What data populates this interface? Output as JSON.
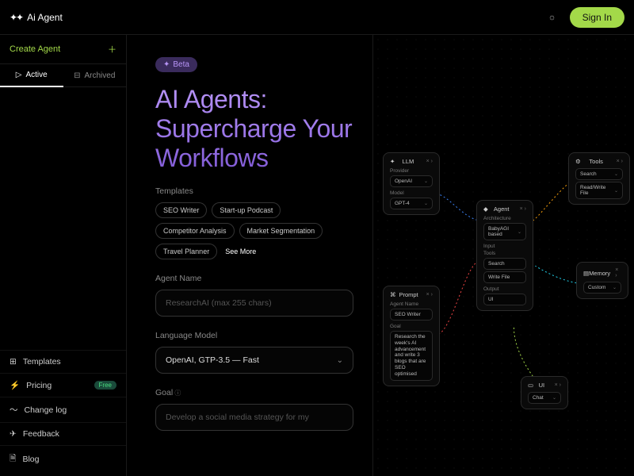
{
  "brand": "Ai Agent",
  "topbar": {
    "signin": "Sign In"
  },
  "sidebar": {
    "create": "Create Agent",
    "tabs": {
      "active": "Active",
      "archived": "Archived"
    },
    "nav": {
      "templates": "Templates",
      "pricing": "Pricing",
      "pricing_badge": "Free",
      "changelog": "Change log",
      "feedback": "Feedback",
      "blog": "Blog"
    }
  },
  "beta": "Beta",
  "hero": "AI Agents: Supercharge Your Workflows",
  "templates_label": "Templates",
  "templates": [
    "SEO Writer",
    "Start-up Podcast",
    "Competitor Analysis",
    "Market Segmentation",
    "Travel Planner"
  ],
  "see_more": "See More",
  "agent_name_label": "Agent Name",
  "agent_name_placeholder": "ResearchAI (max 255 chars)",
  "lm_label": "Language Model",
  "lm_value": "OpenAI, GTP-3.5 — Fast",
  "goal_label": "Goal",
  "goal_placeholder": "Develop a social media strategy for my",
  "graph": {
    "llm": {
      "title": "LLM",
      "provider_label": "Provider",
      "provider": "OpenAI",
      "model_label": "Model",
      "model": "GPT-4"
    },
    "prompt": {
      "title": "Prompt",
      "name_label": "Agent Name",
      "name": "SEO Writer",
      "goal_label": "Goal",
      "goal": "Research the week's AI advancement and write 3 blogs that are SEO optimised"
    },
    "agent": {
      "title": "Agent",
      "arch_label": "Architecture",
      "arch": "BabyAGI based",
      "input_label": "Input",
      "tools_label": "Tools",
      "tools": [
        "Search",
        "Write File"
      ],
      "output_label": "Output",
      "output": "UI"
    },
    "tools": {
      "title": "Tools",
      "items": [
        "Search",
        "Read/Write File"
      ]
    },
    "memory": {
      "title": "Memory",
      "value": "Custom"
    },
    "ui": {
      "title": "UI",
      "value": "Chat"
    }
  }
}
